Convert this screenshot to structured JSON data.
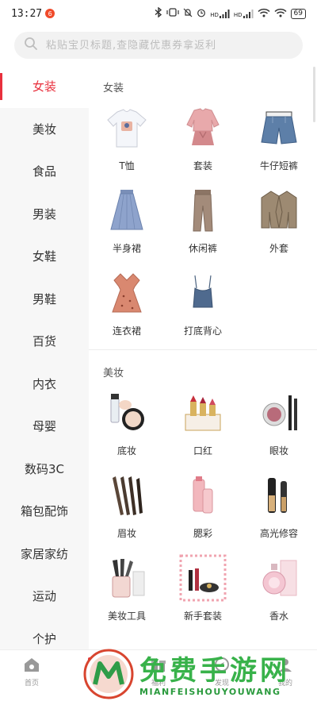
{
  "status_bar": {
    "time": "13:27",
    "app_icon": "6",
    "battery": "69",
    "signal_hd_1": "HD",
    "signal_hd_2": "HD"
  },
  "search": {
    "placeholder": "粘贴宝贝标题,查隐藏优惠券拿返利"
  },
  "sidebar": {
    "items": [
      {
        "label": "女装",
        "active": true
      },
      {
        "label": "美妆"
      },
      {
        "label": "食品"
      },
      {
        "label": "男装"
      },
      {
        "label": "女鞋"
      },
      {
        "label": "男鞋"
      },
      {
        "label": "百货"
      },
      {
        "label": "内衣"
      },
      {
        "label": "母婴"
      },
      {
        "label": "数码3C"
      },
      {
        "label": "箱包配饰"
      },
      {
        "label": "家居家纺"
      },
      {
        "label": "运动"
      },
      {
        "label": "个护"
      }
    ]
  },
  "sections": [
    {
      "title": "女装",
      "items": [
        {
          "label": "T恤",
          "icon": "tshirt-icon"
        },
        {
          "label": "套装",
          "icon": "suit-set-icon"
        },
        {
          "label": "牛仔短裤",
          "icon": "denim-shorts-icon"
        },
        {
          "label": "半身裙",
          "icon": "skirt-icon"
        },
        {
          "label": "休闲裤",
          "icon": "casual-pants-icon"
        },
        {
          "label": "外套",
          "icon": "coat-icon"
        },
        {
          "label": "连衣裙",
          "icon": "dress-icon"
        },
        {
          "label": "打底背心",
          "icon": "camisole-icon"
        }
      ]
    },
    {
      "title": "美妆",
      "items": [
        {
          "label": "底妆",
          "icon": "foundation-icon"
        },
        {
          "label": "口红",
          "icon": "lipstick-icon"
        },
        {
          "label": "眼妆",
          "icon": "eye-makeup-icon"
        },
        {
          "label": "眉妆",
          "icon": "eyebrow-pencil-icon"
        },
        {
          "label": "腮彩",
          "icon": "blush-icon"
        },
        {
          "label": "高光修容",
          "icon": "highlighter-icon"
        },
        {
          "label": "美妆工具",
          "icon": "makeup-brush-icon"
        },
        {
          "label": "新手套装",
          "icon": "starter-kit-icon"
        },
        {
          "label": "香水",
          "icon": "perfume-icon"
        }
      ]
    }
  ],
  "bottom_nav": [
    {
      "label": "首页",
      "icon": "home-icon"
    },
    {
      "label": "分类",
      "icon": "category-icon",
      "active": true
    },
    {
      "label": "福利",
      "icon": "gift-icon"
    },
    {
      "label": "发现",
      "icon": "discover-icon"
    },
    {
      "label": "我的",
      "icon": "profile-icon"
    }
  ],
  "watermark": {
    "title": "免费手游网",
    "subtitle": "MIANFEISHOUYOUWANG"
  },
  "colors": {
    "accent": "#e8303d",
    "watermark_green": "#38b24a"
  }
}
